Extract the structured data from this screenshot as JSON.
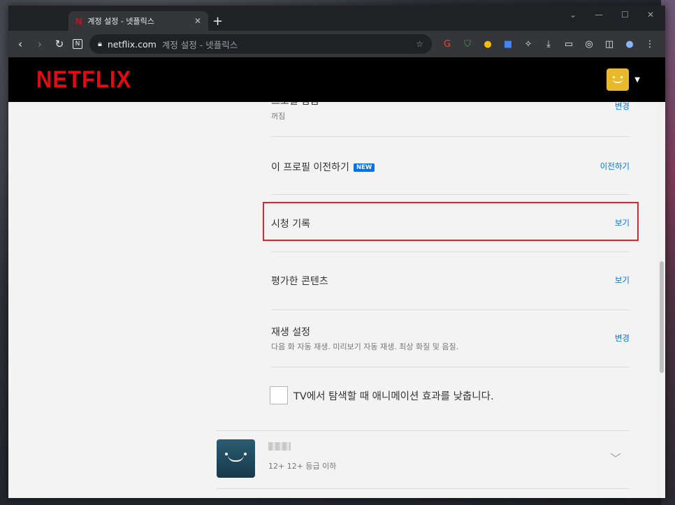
{
  "browser": {
    "tab_title": "계정 설정 - 넷플릭스",
    "tab_favicon": "N",
    "new_tab": "+",
    "url_host": "netflix.com",
    "url_title": "계정 설정 - 넷플릭스"
  },
  "netflix": {
    "logo": "NETFLIX"
  },
  "settings": {
    "partial_row": {
      "label": "프로필 잠금",
      "sub": "꺼짐",
      "action": "변경"
    },
    "transfer": {
      "label": "이 프로필 이전하기",
      "badge": "NEW",
      "action": "이전하기"
    },
    "history": {
      "label": "시청 기록",
      "action": "보기"
    },
    "ratings": {
      "label": "평가한 콘텐츠",
      "action": "보기"
    },
    "playback": {
      "label": "재생 설정",
      "sub": "다음 화 자동 재생. 미리보기 자동 재생. 최상 화질 및 음질.",
      "action": "변경"
    },
    "animation_checkbox": {
      "label": "TV에서 탐색할 때 애니메이션 효과를 낮춥니다.",
      "checked": false
    }
  },
  "next_profile": {
    "rating": "12+ 12+ 등급 이하"
  },
  "colors": {
    "netflix_red": "#e50914",
    "link_blue": "#0073e6",
    "highlight_red": "#e0252c"
  }
}
